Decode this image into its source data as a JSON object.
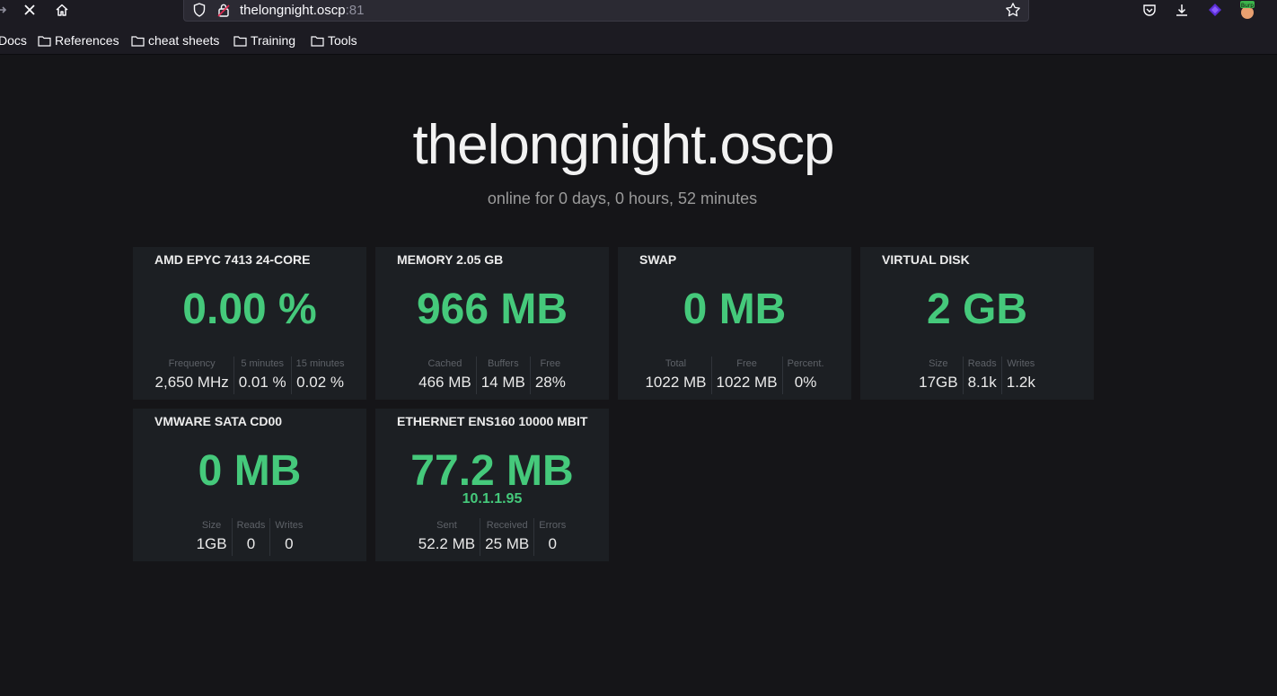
{
  "browser": {
    "url_host": "thelongnight.oscp",
    "url_port": ":81",
    "bookmarks": [
      "Docs",
      "References",
      "cheat sheets",
      "Training",
      "Tools"
    ],
    "toolbar_icons": [
      "pocket-icon",
      "download-icon",
      "extension-icon",
      "burp-extension-icon"
    ],
    "burp_badge": "Burp"
  },
  "page": {
    "title": "thelongnight.oscp",
    "uptime": "online for 0 days, 0 hours, 52 minutes"
  },
  "cards": [
    {
      "title": "AMD EPYC 7413 24-CORE",
      "value": "0.00 %",
      "stats": [
        {
          "label": "Frequency",
          "value": "2,650 MHz"
        },
        {
          "label": "5 minutes",
          "value": "0.01 %"
        },
        {
          "label": "15 minutes",
          "value": "0.02 %"
        }
      ]
    },
    {
      "title": "MEMORY 2.05 GB",
      "value": "966 MB",
      "stats": [
        {
          "label": "Cached",
          "value": "466 MB"
        },
        {
          "label": "Buffers",
          "value": "14 MB"
        },
        {
          "label": "Free",
          "value": "28%"
        }
      ]
    },
    {
      "title": "SWAP",
      "value": "0 MB",
      "stats": [
        {
          "label": "Total",
          "value": "1022 MB"
        },
        {
          "label": "Free",
          "value": "1022 MB"
        },
        {
          "label": "Percent.",
          "value": "0%"
        }
      ]
    },
    {
      "title": "VIRTUAL DISK",
      "value": "2 GB",
      "stats": [
        {
          "label": "Size",
          "value": "17GB"
        },
        {
          "label": "Reads",
          "value": "8.1k"
        },
        {
          "label": "Writes",
          "value": "1.2k"
        }
      ]
    },
    {
      "title": "VMWARE SATA CD00",
      "value": "0 MB",
      "stats": [
        {
          "label": "Size",
          "value": "1GB"
        },
        {
          "label": "Reads",
          "value": "0"
        },
        {
          "label": "Writes",
          "value": "0"
        }
      ]
    },
    {
      "title": "ETHERNET ENS160 10000 MBIT",
      "value": "77.2 MB",
      "subvalue": "10.1.1.95",
      "stats": [
        {
          "label": "Sent",
          "value": "52.2 MB"
        },
        {
          "label": "Received",
          "value": "25 MB"
        },
        {
          "label": "Errors",
          "value": "0"
        }
      ]
    }
  ],
  "colors": {
    "accent_green": "#45c97b",
    "page_background": "#151518",
    "card_background": "#1c1f23"
  }
}
